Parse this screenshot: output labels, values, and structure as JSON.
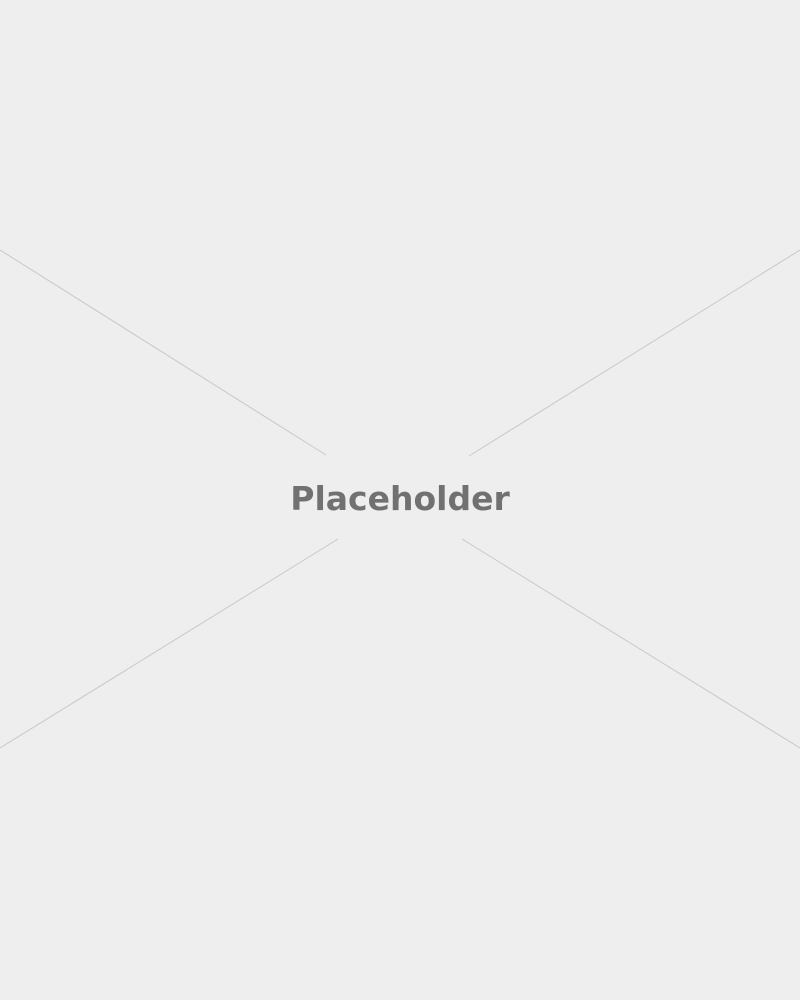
{
  "placeholder": {
    "label": "Placeholder",
    "background_color": "#eeeeee",
    "line_color": "#c8c8c8",
    "text_color": "#717171"
  }
}
